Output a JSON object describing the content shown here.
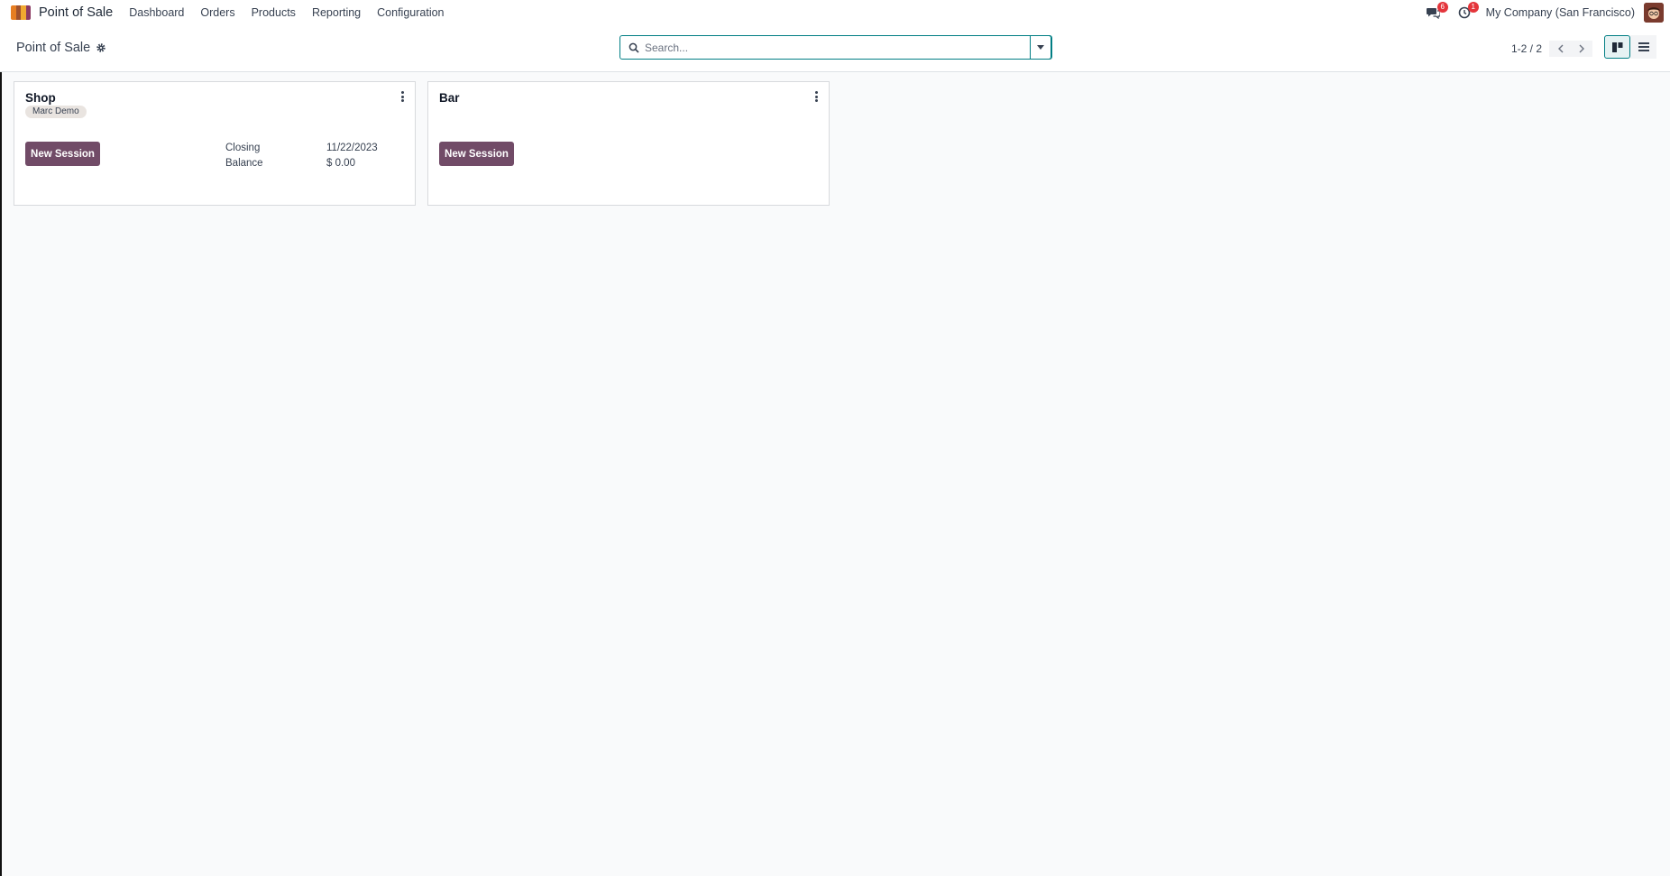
{
  "navbar": {
    "app_name": "Point of Sale",
    "menu": [
      "Dashboard",
      "Orders",
      "Products",
      "Reporting",
      "Configuration"
    ],
    "messages_count": "6",
    "activities_count": "1",
    "company": "My Company (San Francisco)"
  },
  "control_panel": {
    "title": "Point of Sale",
    "search_placeholder": "Search...",
    "pager_value": "1-2 / 2"
  },
  "cards": [
    {
      "title": "Shop",
      "tag": "Marc Demo",
      "button_label": "New Session",
      "closing_label": "Closing",
      "closing_value": "11/22/2023",
      "balance_label": "Balance",
      "balance_value": "$ 0.00"
    },
    {
      "title": "Bar",
      "button_label": "New Session"
    }
  ],
  "colors": {
    "primary": "#714b67",
    "accent": "#017e84",
    "badge": "#e4353b"
  },
  "icons": [
    "app-logo-icon",
    "gear-icon",
    "search-icon",
    "caret-down-icon",
    "chevron-left-icon",
    "chevron-right-icon",
    "kanban-view-icon",
    "list-view-icon",
    "chat-icon",
    "clock-icon",
    "kebab-menu-icon"
  ]
}
